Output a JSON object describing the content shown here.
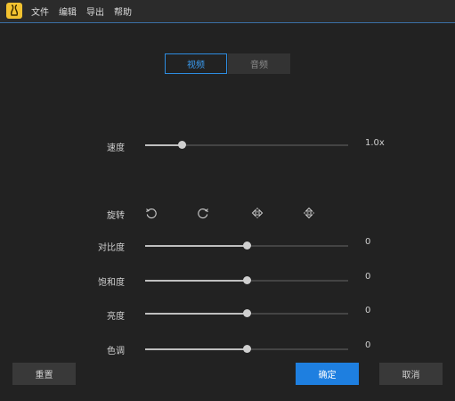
{
  "menubar": {
    "items": [
      "文件",
      "编辑",
      "导出",
      "帮助"
    ]
  },
  "tabs": [
    {
      "label": "视频",
      "active": true
    },
    {
      "label": "音频",
      "active": false
    }
  ],
  "speed": {
    "label": "速度",
    "value": "1.0x",
    "fraction": 0.18
  },
  "rotate": {
    "label": "旋转",
    "icons": [
      "rotate-left-icon",
      "rotate-right-icon",
      "flip-horizontal-icon",
      "flip-vertical-icon"
    ]
  },
  "adjustments": [
    {
      "label": "对比度",
      "value": "0",
      "fraction": 0.5
    },
    {
      "label": "饱和度",
      "value": "0",
      "fraction": 0.5
    },
    {
      "label": "亮度",
      "value": "0",
      "fraction": 0.5
    },
    {
      "label": "色调",
      "value": "0",
      "fraction": 0.5
    }
  ],
  "buttons": {
    "reset": "重置",
    "confirm": "确定",
    "cancel": "取消"
  },
  "colors": {
    "accent": "#1e7fe0",
    "background": "#222222",
    "app_icon": "#f2c230"
  }
}
